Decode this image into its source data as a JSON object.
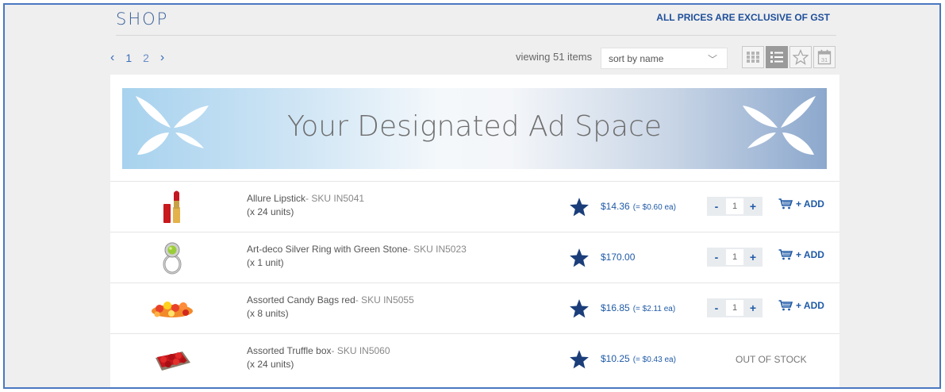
{
  "header": {
    "title": "SHOP",
    "gst_note": "ALL PRICES ARE EXCLUSIVE OF GST"
  },
  "pagination": {
    "prev": "‹",
    "next": "›",
    "pages": [
      "1",
      "2"
    ],
    "current": "1"
  },
  "toolbar": {
    "viewing": "viewing 51 items",
    "sort_value": "sort by name",
    "views": [
      "grid-view-icon",
      "list-view-icon",
      "favourites-view-icon",
      "calendar-view-icon"
    ],
    "active_view": "list-view-icon"
  },
  "ad": {
    "text": "Your Designated Ad Space"
  },
  "colors": {
    "accent": "#1f5aa6",
    "frame": "#4a78c2",
    "star": "#1b3e7a"
  },
  "products": [
    {
      "name": "Allure Lipstick",
      "sku": "- SKU IN5041",
      "units": "(x 24 units)",
      "price": "$14.36",
      "each": "(= $0.60 ea)",
      "qty": "1",
      "add": "+ ADD",
      "in_stock": true,
      "icon": "lipstick-icon"
    },
    {
      "name": "Art-deco Silver Ring with Green Stone",
      "sku": "- SKU IN5023",
      "units": "(x 1 unit)",
      "price": "$170.00",
      "each": "",
      "qty": "1",
      "add": "+ ADD",
      "in_stock": true,
      "icon": "ring-icon"
    },
    {
      "name": "Assorted Candy Bags red",
      "sku": "- SKU IN5055",
      "units": "(x 8 units)",
      "price": "$16.85",
      "each": "(= $2.11 ea)",
      "qty": "1",
      "add": "+ ADD",
      "in_stock": true,
      "icon": "candy-icon"
    },
    {
      "name": "Assorted Truffle box",
      "sku": "- SKU IN5060",
      "units": "(x 24 units)",
      "price": "$10.25",
      "each": "(= $0.43 ea)",
      "qty": "",
      "add": "",
      "in_stock": false,
      "stock_label": "OUT OF STOCK",
      "icon": "truffle-box-icon"
    }
  ]
}
